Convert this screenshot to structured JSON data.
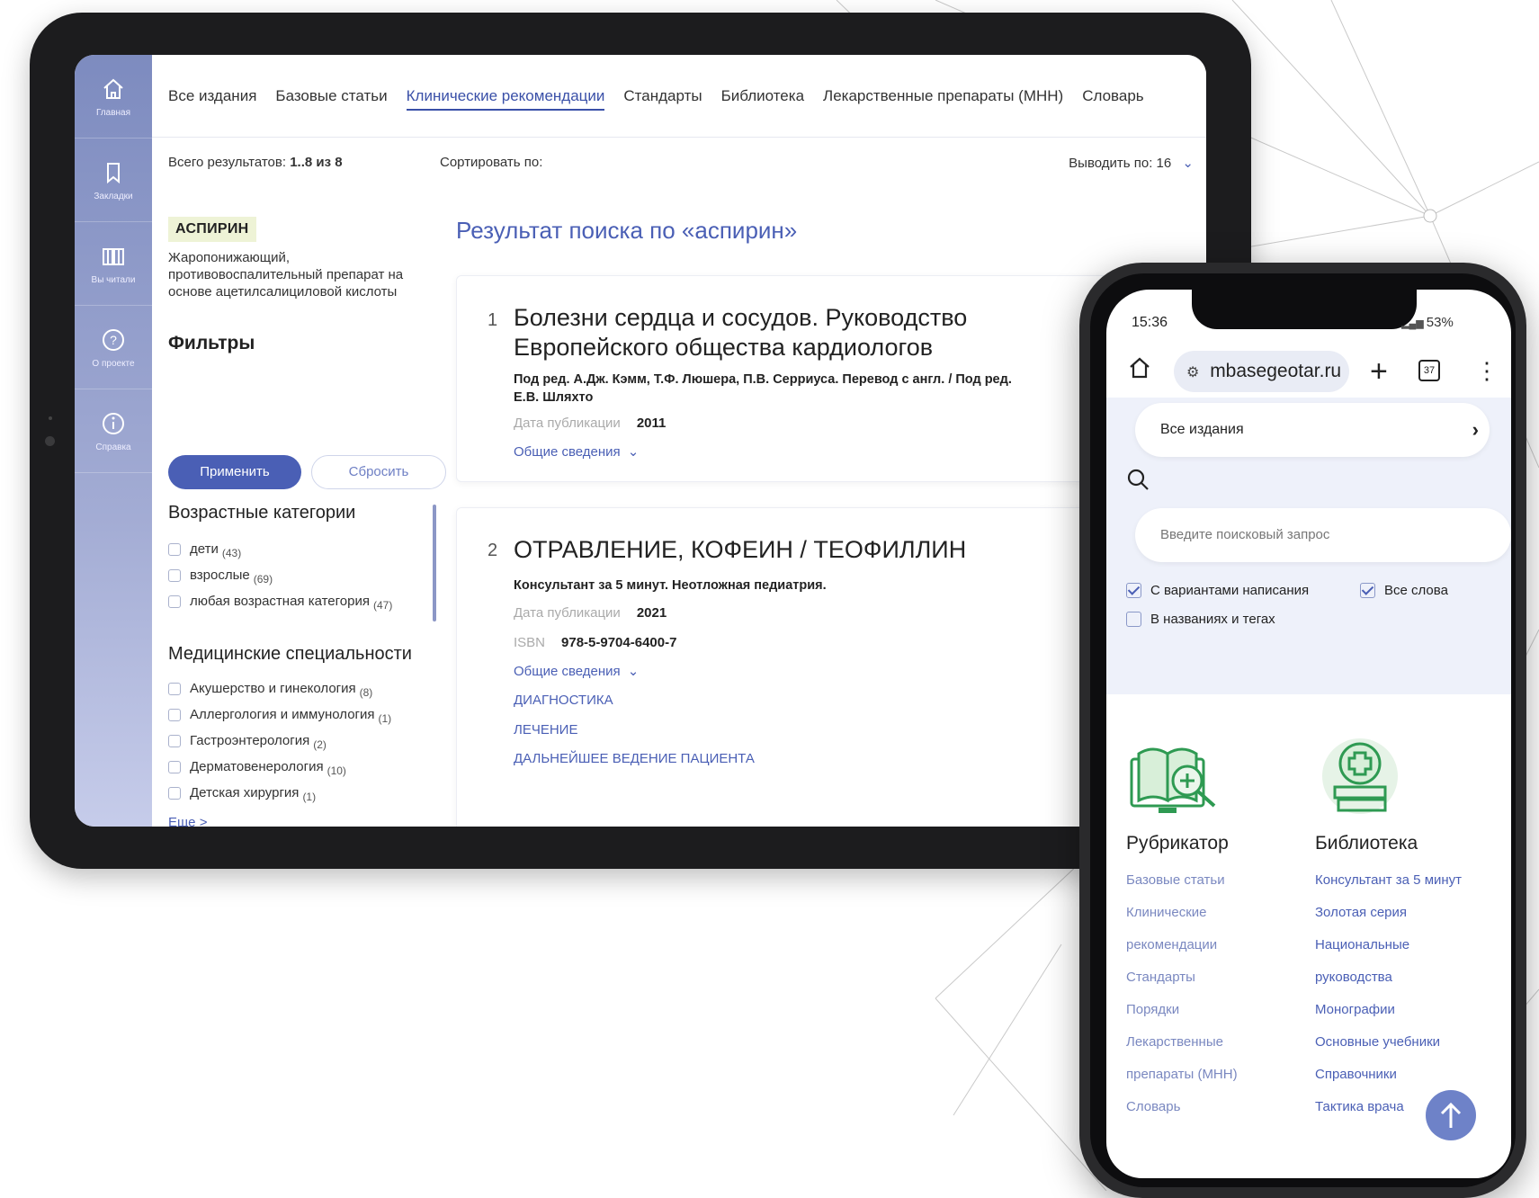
{
  "tablet": {
    "sidebar": [
      {
        "icon": "home-icon",
        "label": "Главная"
      },
      {
        "icon": "bookmark-icon",
        "label": "Закладки"
      },
      {
        "icon": "book-icon",
        "label": "Вы читали"
      },
      {
        "icon": "help-icon",
        "label": "О проекте"
      },
      {
        "icon": "info-icon",
        "label": "Справка"
      }
    ],
    "tabs": [
      "Все издания",
      "Базовые статьи",
      "Клинические рекомендации",
      "Стандарты",
      "Библиотека",
      "Лекарственные препараты (МНН)",
      "Словарь"
    ],
    "active_tab": "Клинические рекомендации",
    "topbar": {
      "total_label": "Всего результатов:",
      "total_value": "1..8 из 8",
      "sort_label": "Сортировать по:",
      "per_page_label": "Выводить по: 16"
    },
    "left": {
      "tag": "АСПИРИН",
      "description": "Жаропонижающий, противовоспалительный препарат на основе ацетилсалициловой кислоты",
      "filters_title": "Фильтры",
      "apply": "Применить",
      "reset": "Сбросить",
      "age_title": "Возрастные категории",
      "age_items": [
        {
          "label": "дети",
          "count": "(43)"
        },
        {
          "label": "взрослые",
          "count": "(69)"
        },
        {
          "label": "любая возрастная категория",
          "count": "(47)"
        }
      ],
      "spec_title": "Медицинские специальности",
      "spec_items": [
        {
          "label": "Акушерство и гинекология",
          "count": "(8)"
        },
        {
          "label": "Аллергология и иммунология",
          "count": "(1)"
        },
        {
          "label": "Гастроэнтерология",
          "count": "(2)"
        },
        {
          "label": "Дерматовенерология",
          "count": "(10)"
        },
        {
          "label": "Детская хирургия",
          "count": "(1)"
        }
      ],
      "more": "Еще >"
    },
    "result_title": "Результат поиска по «аспирин»",
    "results": [
      {
        "num": "1",
        "title": "Болезни сердца и сосудов. Руководство Европейского общества кардиологов",
        "subtitle": "Под ред. А.Дж. Кэмм, Т.Ф. Люшера, П.В. Серриуса. Перевод с англ. / Под ред. Е.В. Шляхто",
        "date_label": "Дата публикации",
        "date": "2011",
        "details": "Общие сведения"
      },
      {
        "num": "2",
        "title": "ОТРАВЛЕНИЕ, КОФЕИН / ТЕОФИЛЛИН",
        "subtitle": "Консультант за 5 минут. Неотложная педиатрия.",
        "date_label": "Дата публикации",
        "date": "2021",
        "isbn_label": "ISBN",
        "isbn": "978-5-9704-6400-7",
        "details": "Общие сведения",
        "sections": [
          "ДИАГНОСТИКА",
          "ЛЕЧЕНИЕ",
          "ДАЛЬНЕЙШЕЕ ВЕДЕНИЕ ПАЦИЕНТА"
        ]
      }
    ]
  },
  "phone": {
    "time": "15:36",
    "battery": "53%",
    "url": "mbasegeotar.ru",
    "tabs_count": "37",
    "select": "Все издания",
    "search_placeholder": "Введите поисковый запрос",
    "checkboxes": [
      {
        "label": "С вариантами написания",
        "checked": true
      },
      {
        "label": "Все слова",
        "checked": true
      },
      {
        "label": "В названиях и тегах",
        "checked": false
      }
    ],
    "col1_title": "Рубрикатор",
    "col1_links": [
      "Базовые статьи",
      "Клинические",
      "рекомендации",
      "Стандарты",
      "Порядки",
      "Лекарственные",
      "препараты (МНН)",
      "Словарь"
    ],
    "col2_title": "Библиотека",
    "col2_links": [
      "Консультант за 5 минут",
      "Золотая серия",
      "Национальные",
      "руководства",
      "Монографии",
      "Основные учебники",
      "Справочники",
      "Тактика врача"
    ]
  },
  "colors": {
    "accent": "#4a5fb5",
    "sidebar": "#8c97c6",
    "green": "#2e9a52"
  }
}
